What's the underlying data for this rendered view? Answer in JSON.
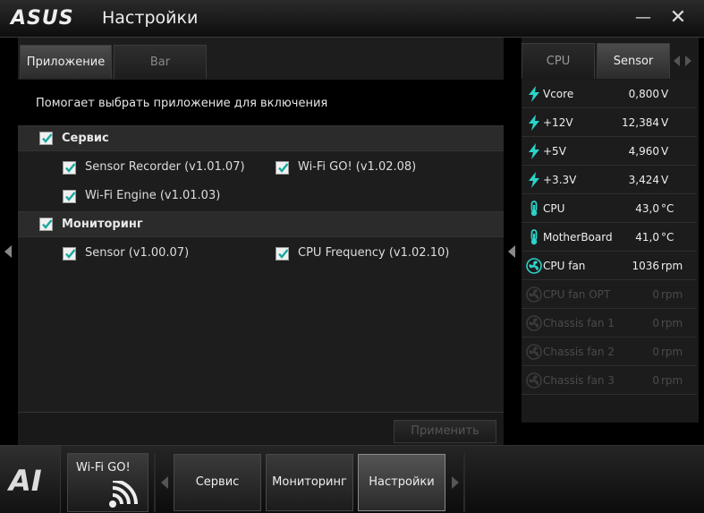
{
  "window": {
    "logo": "ASUS",
    "title": "Настройки",
    "minimize_glyph": "—",
    "close_glyph": "✕"
  },
  "tabs": [
    {
      "label": "Приложение",
      "active": true
    },
    {
      "label": "Bar",
      "active": false
    }
  ],
  "description": "Помогает выбрать приложение для включения",
  "categories": [
    {
      "label": "Сервис",
      "checked": true,
      "items": [
        {
          "label": "Sensor Recorder (v1.01.07)",
          "checked": true
        },
        {
          "label": "Wi-Fi GO! (v1.02.08)",
          "checked": true
        },
        {
          "label": "Wi-Fi Engine (v1.01.03)",
          "checked": true
        }
      ]
    },
    {
      "label": "Мониторинг",
      "checked": true,
      "items": [
        {
          "label": "Sensor (v1.00.07)",
          "checked": true
        },
        {
          "label": "CPU Frequency (v1.02.10)",
          "checked": true
        }
      ]
    }
  ],
  "apply_label": "Применить",
  "sensor_panel": {
    "tabs": [
      {
        "label": "CPU",
        "active": false
      },
      {
        "label": "Sensor",
        "active": true
      }
    ],
    "rows": [
      {
        "icon": "voltage-icon",
        "name": "Vcore",
        "value": "0,800",
        "unit": "V",
        "active": true
      },
      {
        "icon": "voltage-icon",
        "name": "+12V",
        "value": "12,384",
        "unit": "V",
        "active": true
      },
      {
        "icon": "voltage-icon",
        "name": "+5V",
        "value": "4,960",
        "unit": "V",
        "active": true
      },
      {
        "icon": "voltage-icon",
        "name": "+3.3V",
        "value": "3,424",
        "unit": "V",
        "active": true
      },
      {
        "icon": "thermometer-icon",
        "name": "CPU",
        "value": "43,0",
        "unit": "°C",
        "active": true
      },
      {
        "icon": "thermometer-icon",
        "name": "MotherBoard",
        "value": "41,0",
        "unit": "°C",
        "active": true
      },
      {
        "icon": "fan-icon",
        "name": "CPU fan",
        "value": "1036",
        "unit": "rpm",
        "active": true
      },
      {
        "icon": "fan-icon",
        "name": "CPU fan OPT",
        "value": "0",
        "unit": "rpm",
        "active": false
      },
      {
        "icon": "fan-icon",
        "name": "Chassis fan 1",
        "value": "0",
        "unit": "rpm",
        "active": false
      },
      {
        "icon": "fan-icon",
        "name": "Chassis fan 2",
        "value": "0",
        "unit": "rpm",
        "active": false
      },
      {
        "icon": "fan-icon",
        "name": "Chassis fan 3",
        "value": "0",
        "unit": "rpm",
        "active": false
      }
    ]
  },
  "bottom_bar": {
    "logo": "AI",
    "wifi_tile": "Wi-Fi GO!",
    "buttons": [
      {
        "label": "Сервис",
        "active": false
      },
      {
        "label": "Мониторинг",
        "active": false
      },
      {
        "label": "Настройки",
        "active": true
      }
    ]
  },
  "colors": {
    "accent_teal": "#2bd3c9",
    "checkbox_check": "#1aa79e",
    "background": "#1d1d1d"
  }
}
